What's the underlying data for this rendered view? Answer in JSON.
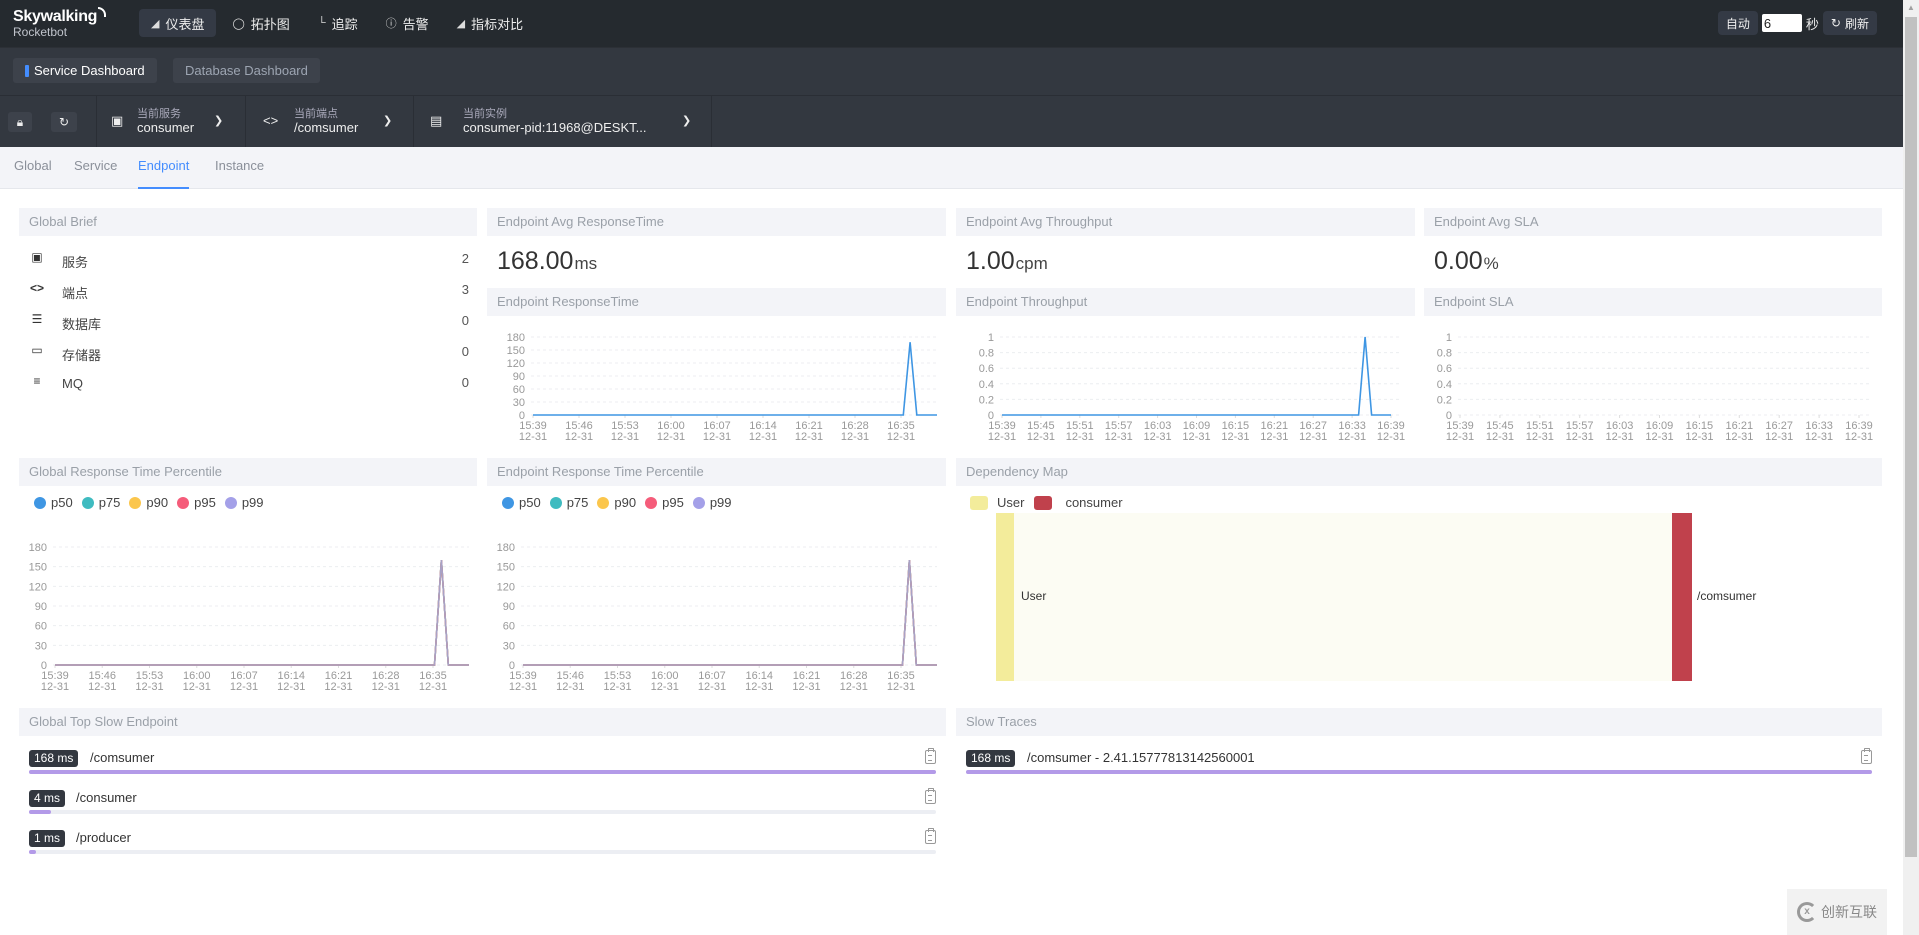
{
  "app": {
    "logo_title": "Skywalking",
    "logo_subtitle": "Rocketbot"
  },
  "topnav": {
    "items": [
      {
        "label": "仪表盘",
        "icon": "chart-icon",
        "active": true
      },
      {
        "label": "拓扑图",
        "icon": "topology-icon",
        "active": false
      },
      {
        "label": "追踪",
        "icon": "trace-icon",
        "active": false
      },
      {
        "label": "告警",
        "icon": "alarm-icon",
        "active": false
      },
      {
        "label": "指标对比",
        "icon": "chart-icon",
        "active": false
      }
    ],
    "auto_label": "自动",
    "interval_value": "6",
    "seconds_label": "秒",
    "refresh_label": "刷新"
  },
  "dashboards": {
    "tabs": [
      {
        "label": "Service Dashboard",
        "active": true
      },
      {
        "label": "Database Dashboard",
        "active": false
      }
    ]
  },
  "selectors": {
    "service": {
      "label": "当前服务",
      "value": "consumer"
    },
    "endpoint": {
      "label": "当前端点",
      "value": "/comsumer"
    },
    "instance": {
      "label": "当前实例",
      "value": "consumer-pid:11968@DESKT..."
    }
  },
  "subtabs": [
    {
      "label": "Global",
      "active": false
    },
    {
      "label": "Service",
      "active": false
    },
    {
      "label": "Endpoint",
      "active": true
    },
    {
      "label": "Instance",
      "active": false
    }
  ],
  "global_brief": {
    "title": "Global Brief",
    "rows": [
      {
        "icon": "service-icon",
        "label": "服务",
        "value": "2"
      },
      {
        "icon": "code-icon",
        "label": "端点",
        "value": "3"
      },
      {
        "icon": "database-icon",
        "label": "数据库",
        "value": "0"
      },
      {
        "icon": "storage-icon",
        "label": "存储器",
        "value": "0"
      },
      {
        "icon": "mq-icon",
        "label": "MQ",
        "value": "0"
      }
    ]
  },
  "avg_cards": [
    {
      "title": "Endpoint Avg ResponseTime",
      "value": "168.00",
      "unit": "ms"
    },
    {
      "title": "Endpoint Avg Throughput",
      "value": "1.00",
      "unit": "cpm"
    },
    {
      "title": "Endpoint Avg SLA",
      "value": "0.00",
      "unit": "%"
    }
  ],
  "chart_data": [
    {
      "id": "endpoint-responsetime",
      "type": "line",
      "title": "Endpoint ResponseTime",
      "x": [
        "15:39",
        "15:46",
        "15:53",
        "16:00",
        "16:07",
        "16:14",
        "16:21",
        "16:28",
        "16:35"
      ],
      "x_sub": "12-31",
      "yticks": [
        0,
        30,
        60,
        90,
        120,
        150,
        180
      ],
      "ylim": [
        0,
        180
      ],
      "points": 61,
      "spike_index": 56,
      "series": [
        {
          "name": "ResponseTime",
          "color": "#3f96e3",
          "zero_except": {
            "56": 168
          }
        }
      ],
      "grid": true
    },
    {
      "id": "endpoint-throughput",
      "type": "line",
      "title": "Endpoint Throughput",
      "x": [
        "15:39",
        "15:45",
        "15:51",
        "15:57",
        "16:03",
        "16:09",
        "16:15",
        "16:21",
        "16:27",
        "16:33",
        "16:39"
      ],
      "x_sub": "12-31",
      "yticks": [
        0,
        0.2,
        0.4,
        0.6,
        0.8,
        1
      ],
      "ylim": [
        0,
        1
      ],
      "points": 61,
      "series": [
        {
          "name": "Throughput",
          "color": "#3f96e3",
          "zero_except": {
            "56": 1
          }
        }
      ],
      "grid": true
    },
    {
      "id": "endpoint-sla",
      "type": "line",
      "title": "Endpoint SLA",
      "x": [
        "15:39",
        "15:45",
        "15:51",
        "15:57",
        "16:03",
        "16:09",
        "16:15",
        "16:21",
        "16:27",
        "16:33",
        "16:39"
      ],
      "x_sub": "12-31",
      "yticks": [
        0,
        0.2,
        0.4,
        0.6,
        0.8,
        1
      ],
      "ylim": [
        0,
        1
      ],
      "points": 61,
      "series": [],
      "grid": true
    },
    {
      "id": "global-percentile",
      "type": "line",
      "title": "Global Response Time Percentile",
      "x": [
        "15:39",
        "15:46",
        "15:53",
        "16:00",
        "16:07",
        "16:14",
        "16:21",
        "16:28",
        "16:35"
      ],
      "x_sub": "12-31",
      "yticks": [
        0,
        30,
        60,
        90,
        120,
        150,
        180
      ],
      "ylim": [
        0,
        180
      ],
      "points": 61,
      "legend": [
        {
          "name": "p50",
          "color": "#3f96e3"
        },
        {
          "name": "p75",
          "color": "#3fbbc0"
        },
        {
          "name": "p90",
          "color": "#fbc64c"
        },
        {
          "name": "p95",
          "color": "#f55c7a"
        },
        {
          "name": "p99",
          "color": "#a4a0e8"
        }
      ],
      "series": [
        {
          "name": "p50",
          "color": "#3f96e3",
          "zero_except": {
            "56": 160
          }
        },
        {
          "name": "p75",
          "color": "#3fbbc0",
          "zero_except": {
            "56": 160
          }
        },
        {
          "name": "p90",
          "color": "#fbc64c",
          "zero_except": {
            "56": 160
          }
        },
        {
          "name": "p95",
          "color": "#f55c7a",
          "zero_except": {
            "56": 160
          }
        },
        {
          "name": "p99",
          "color": "#a8a2c6",
          "zero_except": {
            "56": 160
          }
        }
      ],
      "grid": true
    },
    {
      "id": "endpoint-percentile",
      "type": "line",
      "title": "Endpoint Response Time Percentile",
      "x": [
        "15:39",
        "15:46",
        "15:53",
        "16:00",
        "16:07",
        "16:14",
        "16:21",
        "16:28",
        "16:35"
      ],
      "x_sub": "12-31",
      "yticks": [
        0,
        30,
        60,
        90,
        120,
        150,
        180
      ],
      "ylim": [
        0,
        180
      ],
      "points": 61,
      "legend": [
        {
          "name": "p50",
          "color": "#3f96e3"
        },
        {
          "name": "p75",
          "color": "#3fbbc0"
        },
        {
          "name": "p90",
          "color": "#fbc64c"
        },
        {
          "name": "p95",
          "color": "#f55c7a"
        },
        {
          "name": "p99",
          "color": "#a4a0e8"
        }
      ],
      "series": [
        {
          "name": "p50",
          "color": "#3f96e3",
          "zero_except": {
            "56": 160
          }
        },
        {
          "name": "p75",
          "color": "#3fbbc0",
          "zero_except": {
            "56": 160
          }
        },
        {
          "name": "p90",
          "color": "#fbc64c",
          "zero_except": {
            "56": 160
          }
        },
        {
          "name": "p95",
          "color": "#f55c7a",
          "zero_except": {
            "56": 160
          }
        },
        {
          "name": "p99",
          "color": "#a8a2c6",
          "zero_except": {
            "56": 160
          }
        }
      ],
      "grid": true
    }
  ],
  "dependency_map": {
    "title": "Dependency Map",
    "legend": [
      {
        "name": "User",
        "color": "#f3ec9b"
      },
      {
        "name": "consumer",
        "color": "#c0414c"
      }
    ],
    "source_node": "User",
    "target_node": "/comsumer"
  },
  "top_slow": {
    "title": "Global Top Slow Endpoint",
    "rows": [
      {
        "duration": "168 ms",
        "endpoint": "/comsumer",
        "value": 168
      },
      {
        "duration": "4 ms",
        "endpoint": "/consumer",
        "value": 4
      },
      {
        "duration": "1 ms",
        "endpoint": "/producer",
        "value": 1
      }
    ],
    "max": 168
  },
  "slow_traces": {
    "title": "Slow Traces",
    "rows": [
      {
        "duration": "168 ms",
        "label": "/comsumer - 2.41.15777813142560001",
        "value": 168
      }
    ],
    "max": 168
  },
  "watermark": "创新互联"
}
